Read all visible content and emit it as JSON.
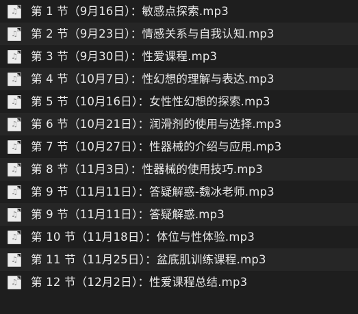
{
  "file_list": {
    "icon": "audio-file-icon",
    "icon_glyph": "♫",
    "items": [
      {
        "name": "第 1 节（9月16日）：敏感点探索.mp3"
      },
      {
        "name": "第 2 节（9月23日）：情感关系与自我认知.mp3"
      },
      {
        "name": "第 3 节（9月30日）：性爱课程.mp3"
      },
      {
        "name": "第 4 节（10月7日）：性幻想的理解与表达.mp3"
      },
      {
        "name": "第 5 节（10月16日）：女性性幻想的探索.mp3"
      },
      {
        "name": "第 6 节（10月21日）：润滑剂的使用与选择.mp3"
      },
      {
        "name": "第 7 节（10月27日）：性器械的介绍与应用.mp3"
      },
      {
        "name": "第 8 节（11月3日）：性器械的使用技巧.mp3"
      },
      {
        "name": "第 9 节（11月11日）：答疑解惑-魏冰老师.mp3"
      },
      {
        "name": "第 9 节（11月11日）：答疑解惑.mp3"
      },
      {
        "name": "第 10 节（11月18日）：体位与性体验.mp3"
      },
      {
        "name": "第 11 节（11月25日）：盆底肌训练课程.mp3"
      },
      {
        "name": "第 12 节（12月2日）：性爱课程总结.mp3"
      }
    ]
  }
}
